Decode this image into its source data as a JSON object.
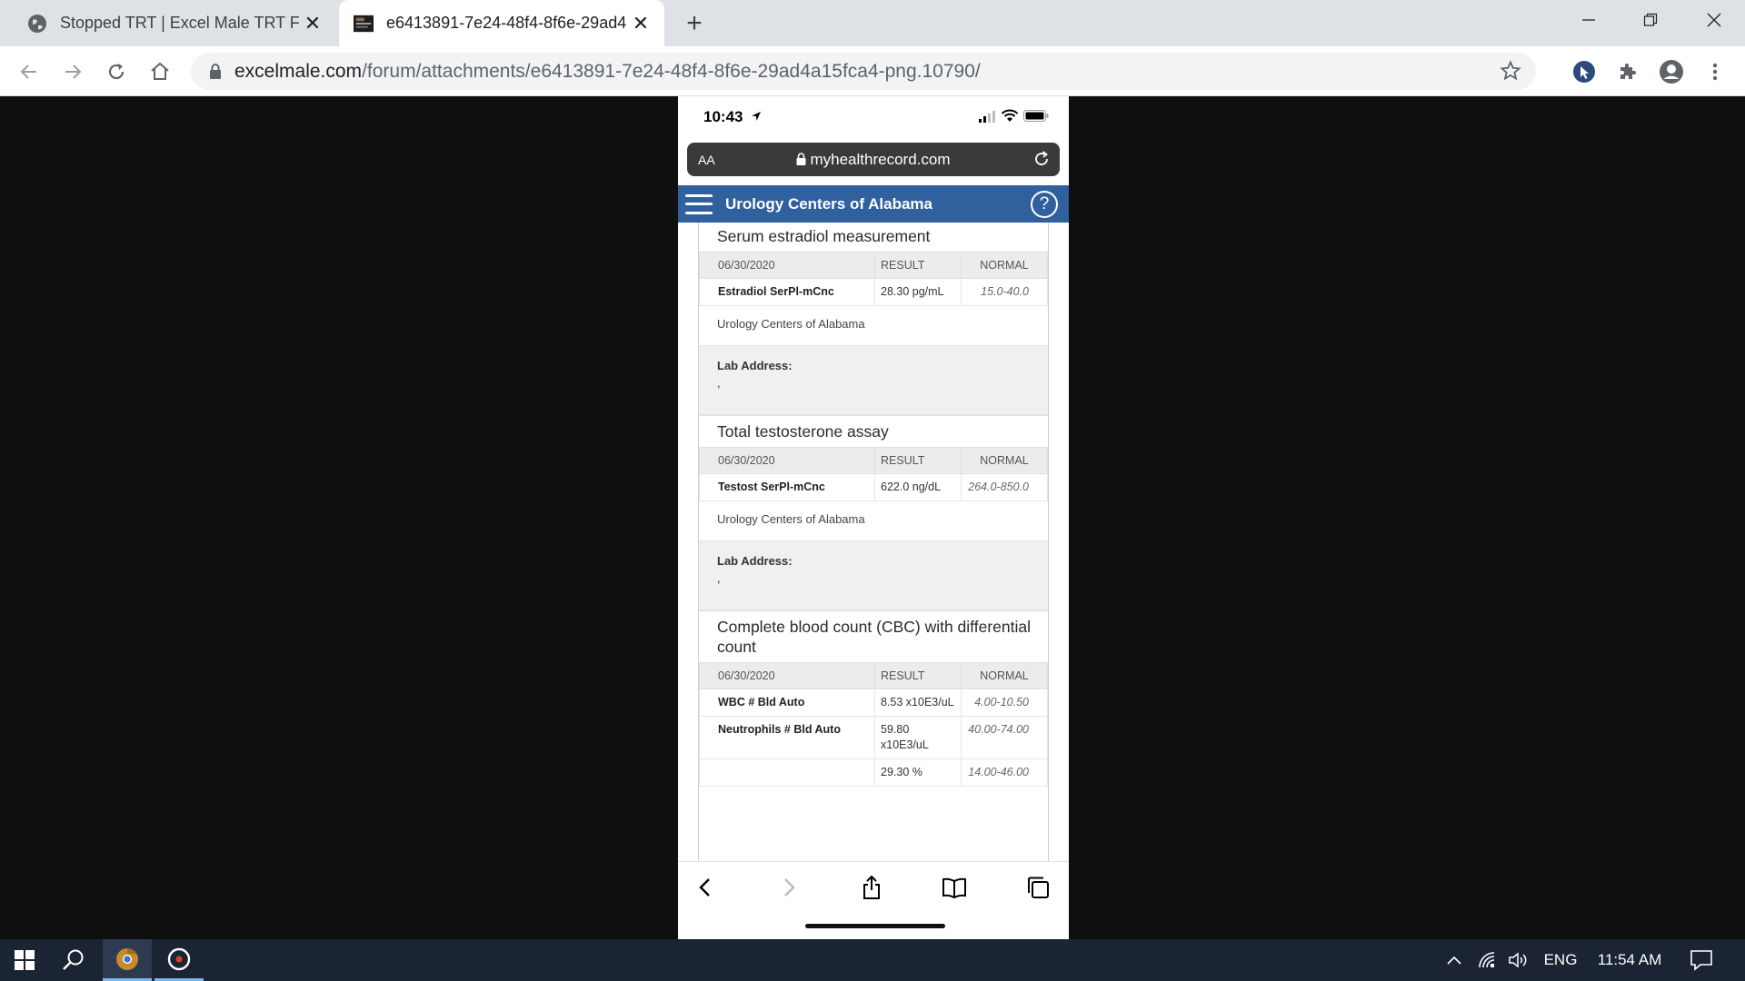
{
  "browser": {
    "tabs": [
      {
        "title": "Stopped TRT | Excel Male TRT For",
        "favicon": "globe-icon",
        "active": false
      },
      {
        "title": "e6413891-7e24-48f4-8f6e-29ad4",
        "favicon": "image-thumbnail-icon",
        "active": true
      }
    ],
    "address": {
      "host": "excelmale.com",
      "path": "/forum/attachments/e6413891-7e24-48f4-8f6e-29ad4a15fca4-png.10790/"
    }
  },
  "phone": {
    "time": "10:43",
    "url_bar": {
      "text_size": "AA",
      "domain": "myhealthrecord.com"
    },
    "header_title": "Urology Centers of Alabama",
    "help_symbol": "?",
    "records": [
      {
        "title": "Serum estradiol measurement",
        "date": "06/30/2020",
        "result_header": "RESULT",
        "normal_header": "NORMAL",
        "rows": [
          {
            "name": "Estradiol SerPl-mCnc",
            "result": "28.30 pg/mL",
            "normal": "15.0-40.0"
          }
        ],
        "lab_name": "Urology Centers of Alabama",
        "lab_address_label": "Lab Address:",
        "lab_address_value": ","
      },
      {
        "title": "Total testosterone assay",
        "date": "06/30/2020",
        "result_header": "RESULT",
        "normal_header": "NORMAL",
        "rows": [
          {
            "name": "Testost SerPl-mCnc",
            "result": "622.0 ng/dL",
            "normal": "264.0-850.0"
          }
        ],
        "lab_name": "Urology Centers of Alabama",
        "lab_address_label": "Lab Address:",
        "lab_address_value": ","
      },
      {
        "title": "Complete blood count (CBC) with differential count",
        "date": "06/30/2020",
        "result_header": "RESULT",
        "normal_header": "NORMAL",
        "rows": [
          {
            "name": "WBC # Bld Auto",
            "result": "8.53 x10E3/uL",
            "normal": "4.00-10.50"
          },
          {
            "name": "Neutrophils # Bld Auto",
            "result": "59.80 x10E3/uL",
            "normal": "40.00-74.00"
          },
          {
            "name": "",
            "result": "29.30 %",
            "normal": "14.00-46.00"
          }
        ]
      }
    ]
  },
  "taskbar": {
    "language": "ENG",
    "clock": "11:54 AM"
  },
  "colors": {
    "app_header": "#30609e",
    "taskbar": "#1a2433",
    "tabstrip": "#dee1e6"
  }
}
